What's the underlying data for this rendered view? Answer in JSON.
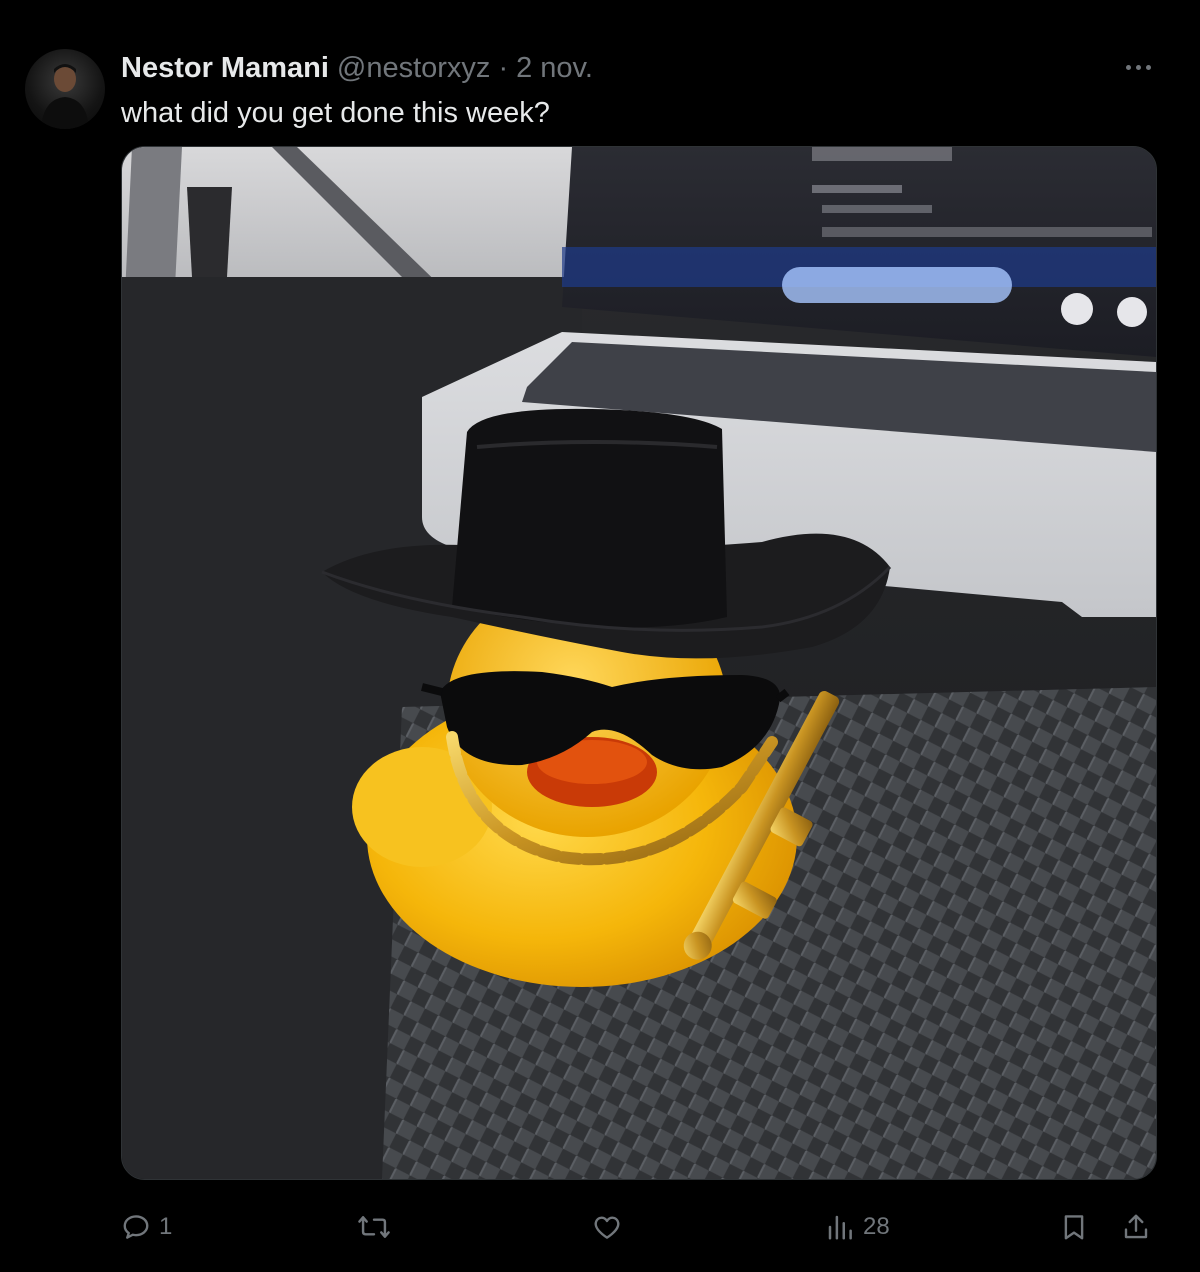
{
  "post": {
    "author_name": "Nestor Mamani",
    "author_handle": "@nestorxyz",
    "separator": "·",
    "date": "2 nov.",
    "text": "what did you get done this week?",
    "image_description_icon": "photo-of-rubber-duck"
  },
  "actions": {
    "reply_icon": "reply-icon",
    "reply_count": "1",
    "repost_icon": "repost-icon",
    "like_icon": "heart-icon",
    "views_icon": "views-chart-icon",
    "views_count": "28",
    "bookmark_icon": "bookmark-icon",
    "share_icon": "share-icon"
  },
  "colors": {
    "background": "#000000",
    "text_primary": "#e7e9ea",
    "text_secondary": "#71767b",
    "border": "#2f3336"
  }
}
